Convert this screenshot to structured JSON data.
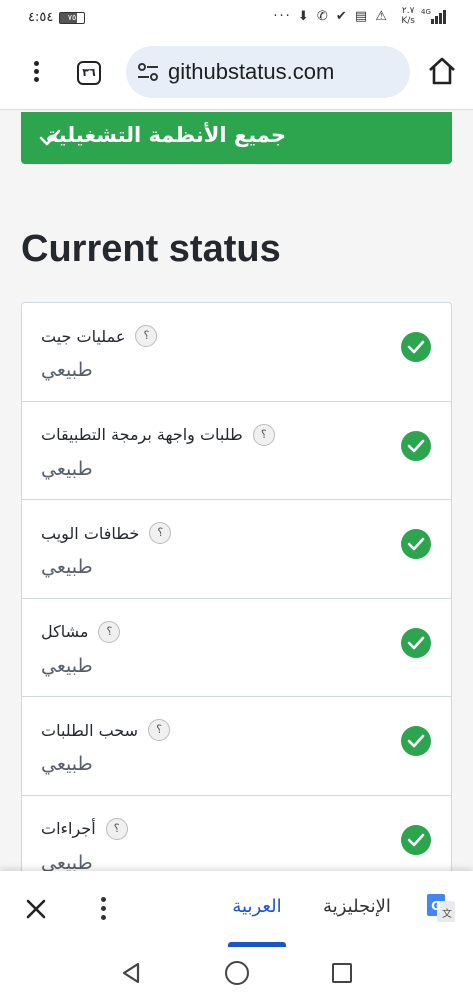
{
  "status_bar": {
    "time": "٤:٥٤",
    "battery": "٧٥",
    "notification_icons": "··· ⬇ ✆ ✔ ▤ ⚠",
    "net_speed_value": "٢.٧",
    "net_speed_unit": "K/s",
    "network": "4G"
  },
  "browser": {
    "tab_count": "٣٦",
    "url": "githubstatus.com"
  },
  "banner": {
    "text": "جميع الأنظمة التشغيلية",
    "color": "#2da44e"
  },
  "section_title": "Current status",
  "components": [
    {
      "name": "عمليات جيت",
      "help": "؟",
      "status": "طبيعي"
    },
    {
      "name": "طلبات واجهة برمجة التطبيقات",
      "help": "؟",
      "status": "طبيعي"
    },
    {
      "name": "خطافات الويب",
      "help": "؟",
      "status": "طبيعي"
    },
    {
      "name": "مشاكل",
      "help": "؟",
      "status": "طبيعي"
    },
    {
      "name": "سحب الطلبات",
      "help": "؟",
      "status": "طبيعي"
    },
    {
      "name": "أجراءات",
      "help": "؟",
      "status": "طبيعي"
    }
  ],
  "translate_bar": {
    "target_language": "العربية",
    "source_language": "الإنجليزية",
    "accent_color": "#1a56c6"
  }
}
